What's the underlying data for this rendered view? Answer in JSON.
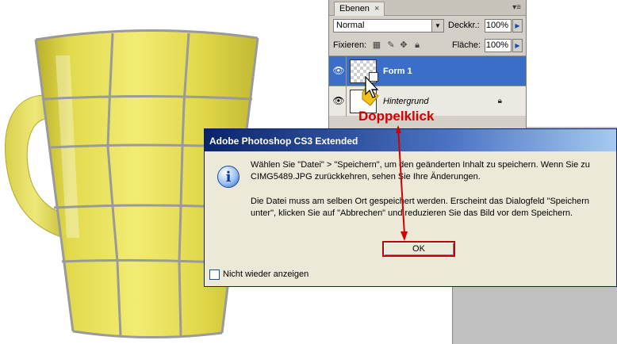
{
  "layers_panel": {
    "tab_label": "Ebenen",
    "tab_close": "×",
    "blend_mode": "Normal",
    "opacity_label": "Deckkr.:",
    "opacity_value": "100%",
    "lock_label": "Fixieren:",
    "fill_label": "Fläche:",
    "fill_value": "100%",
    "layers": [
      {
        "name": "Form 1",
        "selected": true
      },
      {
        "name": "Hintergrund",
        "selected": false
      }
    ]
  },
  "annotation": {
    "label": "Doppelklick",
    "color": "#d40000"
  },
  "dialog": {
    "title": "Adobe Photoshop CS3 Extended",
    "message_1": "Wählen Sie \"Datei\" > \"Speichern\", um den geänderten Inhalt zu speichern. Wenn Sie zu CIMG5489.JPG zurückkehren, sehen Sie Ihre Änderungen.",
    "message_2": "Die Datei muss am selben Ort gespeichert werden. Erscheint das Dialogfeld \"Speichern unter\", klicken Sie auf \"Abbrechen\" und reduzieren Sie das Bild vor dem Speichern.",
    "ok_label": "OK",
    "checkbox_label": "Nicht wieder anzeigen",
    "checkbox_checked": false,
    "icon": "info-icon"
  },
  "colors": {
    "mug_yellow": "#e6dd4a",
    "grid_gray": "#9a9a9a",
    "selected_layer": "#3a6ec8",
    "title_bar": "#0a246a"
  }
}
